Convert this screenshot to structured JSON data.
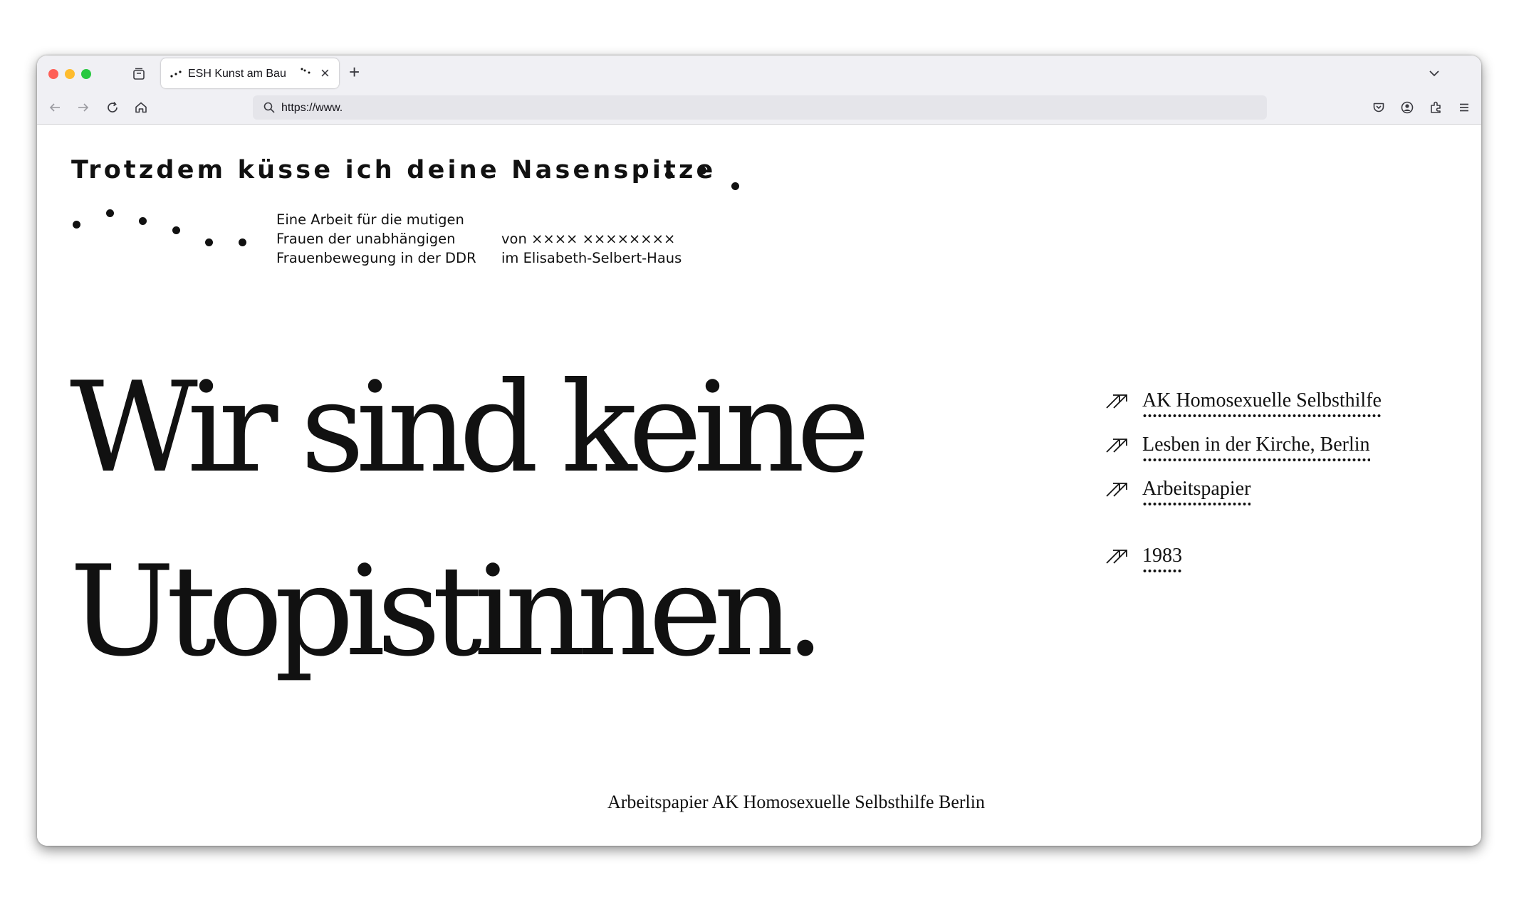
{
  "browser": {
    "tab_title": "ESH Kunst am Bau",
    "close_glyph": "×",
    "new_tab_glyph": "+",
    "url": "https://www.",
    "icons": [
      "back-icon",
      "forward-icon",
      "reload-icon",
      "home-icon",
      "search-icon",
      "tab-overview-icon",
      "pocket-icon",
      "account-icon",
      "extensions-icon",
      "menu-icon",
      "chevron-down-icon"
    ]
  },
  "site": {
    "title": "Trotzdem küsse ich deine Nasenspitze",
    "intro_left": [
      "Eine Arbeit für die mutigen",
      "Frauen der unabhängigen",
      "Frauenbewegung in der DDR"
    ],
    "intro_right": [
      "von  ×××× ××××××××",
      "im Elisabeth-Selbert-Haus"
    ],
    "headline_lines": [
      "Wir sind keine",
      "Utopistinnen."
    ],
    "links": [
      {
        "label": "AK Homosexuelle Selbsthilfe"
      },
      {
        "label": "Lesben in der Kirche, Berlin"
      },
      {
        "label": "Arbeitspapier"
      },
      {
        "label": "1983"
      }
    ],
    "footer": "Arbeitspapier AK Homosexuelle Selbsthilfe Berlin"
  },
  "colors": {
    "text": "#111111",
    "chrome": "#f0f0f4",
    "urlbar": "#e5e5ea"
  }
}
